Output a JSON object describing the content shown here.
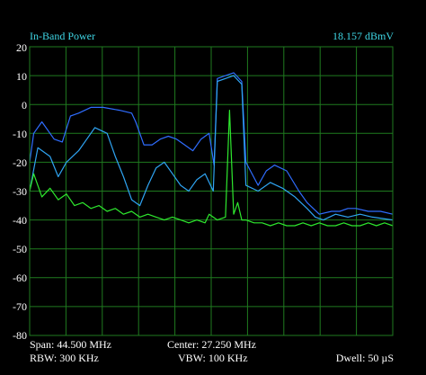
{
  "header": {
    "measurement_label": "In-Band Power",
    "measurement_value": "18.157 dBmV"
  },
  "footer": {
    "span": "Span: 44.500 MHz",
    "center": "Center: 27.250 MHz",
    "rbw": "RBW: 300 KHz",
    "vbw": "VBW: 100 KHz",
    "dwell": "Dwell: 50 µS"
  },
  "y_axis": {
    "tick_labels": [
      "20",
      "10",
      "0",
      "-10",
      "-20",
      "-30",
      "-40",
      "-50",
      "-60",
      "-70",
      "-80"
    ]
  },
  "colors": {
    "background": "#000000",
    "grid": "#1f7a1f",
    "header_text": "#3fd7e6",
    "footer_text": "#ffffff",
    "trace_max_hold": "#2f6dff",
    "trace_live": "#2fa4f2",
    "trace_noise": "#2ee82e"
  },
  "chart_data": {
    "type": "line",
    "ylim": [
      -80,
      20
    ],
    "grid": true,
    "x_range_mhz": [
      5.0,
      49.5
    ],
    "series": [
      {
        "role": "max_hold",
        "color": "#2f6dff",
        "x": [
          5.0,
          5.5,
          6.5,
          8.0,
          9.0,
          10.0,
          11.0,
          12.5,
          14.0,
          16.0,
          17.5,
          18.0,
          19.0,
          20.0,
          21.0,
          22.0,
          23.0,
          24.0,
          25.0,
          26.0,
          27.0,
          27.6,
          28.0,
          30.0,
          31.0,
          31.5,
          33.0,
          34.0,
          35.0,
          36.5,
          38.0,
          39.0,
          40.5,
          42.0,
          43.0,
          44.0,
          45.0,
          46.5,
          48.0,
          49.5
        ],
        "y": [
          -20,
          -10,
          -6,
          -12,
          -13,
          -4,
          -3,
          -1,
          -1,
          -2,
          -3,
          -6,
          -14,
          -14,
          -12,
          -11,
          -12,
          -14,
          -16,
          -12,
          -10,
          -21,
          9,
          11,
          8,
          -20,
          -28,
          -23,
          -21,
          -23,
          -30,
          -34,
          -38,
          -37,
          -37,
          -36,
          -36,
          -37,
          -37,
          -38
        ]
      },
      {
        "role": "live",
        "color": "#2fa4f2",
        "x": [
          5.0,
          6.0,
          7.5,
          8.5,
          9.5,
          11.0,
          12.0,
          13.0,
          14.5,
          15.5,
          16.5,
          17.5,
          18.5,
          19.5,
          20.5,
          21.5,
          22.5,
          23.5,
          24.5,
          25.5,
          26.5,
          27.5,
          28.0,
          30.0,
          31.0,
          31.5,
          33.0,
          34.5,
          36.0,
          37.5,
          39.0,
          40.0,
          41.0,
          42.5,
          44.0,
          45.5,
          47.0,
          49.5
        ],
        "y": [
          -30,
          -15,
          -18,
          -25,
          -20,
          -16,
          -12,
          -8,
          -10,
          -18,
          -25,
          -33,
          -35,
          -28,
          -22,
          -20,
          -24,
          -28,
          -30,
          -26,
          -24,
          -30,
          8,
          10,
          7,
          -28,
          -30,
          -27,
          -29,
          -32,
          -36,
          -39,
          -40,
          -38,
          -39,
          -38,
          -39,
          -40
        ]
      },
      {
        "role": "noise",
        "color": "#2ee82e",
        "x": [
          5.0,
          5.5,
          6.5,
          7.5,
          8.5,
          9.5,
          10.5,
          11.5,
          12.5,
          13.5,
          14.5,
          15.5,
          16.5,
          17.5,
          18.5,
          19.5,
          20.5,
          21.5,
          22.5,
          23.5,
          24.5,
          25.5,
          26.5,
          27.0,
          28.0,
          29.0,
          29.5,
          30.0,
          30.5,
          31.0,
          31.5,
          32.5,
          33.5,
          34.5,
          35.5,
          36.5,
          37.5,
          38.5,
          39.5,
          40.5,
          41.5,
          42.5,
          43.5,
          44.5,
          45.5,
          46.5,
          47.5,
          48.5,
          49.5
        ],
        "y": [
          -30,
          -24,
          -32,
          -29,
          -33,
          -31,
          -35,
          -34,
          -36,
          -35,
          -37,
          -36,
          -38,
          -37,
          -39,
          -38,
          -39,
          -40,
          -39,
          -40,
          -41,
          -40,
          -41,
          -38,
          -40,
          -39,
          -2,
          -38,
          -34,
          -40,
          -40,
          -41,
          -41,
          -42,
          -41,
          -42,
          -42,
          -41,
          -42,
          -41,
          -42,
          -42,
          -41,
          -42,
          -42,
          -41,
          -42,
          -41,
          -42
        ]
      }
    ]
  }
}
